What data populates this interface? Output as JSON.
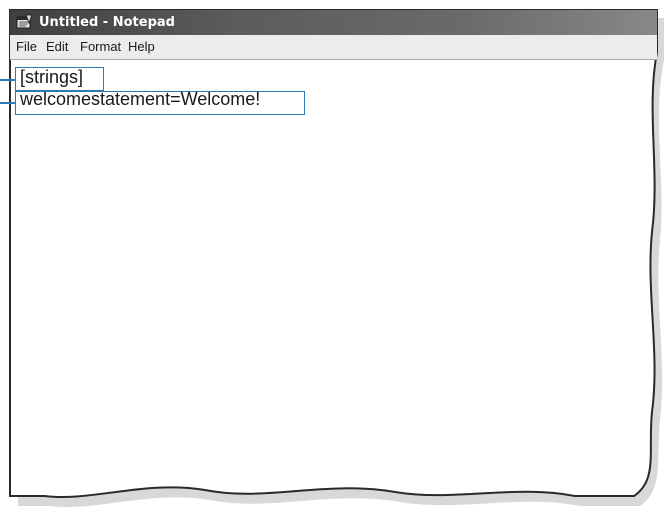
{
  "window": {
    "title": "Untitled - Notepad",
    "app_icon": "notepad-icon"
  },
  "menubar": {
    "items": [
      {
        "label": "File"
      },
      {
        "label": "Edit"
      },
      {
        "label": "Format"
      },
      {
        "label": "Help"
      }
    ]
  },
  "editor": {
    "lines": [
      "[strings]",
      "welcomestatement=Welcome!"
    ]
  },
  "colors": {
    "callout": "#2c7ab0",
    "titlebar": "#5c5c5c",
    "menubar": "#ececec"
  }
}
